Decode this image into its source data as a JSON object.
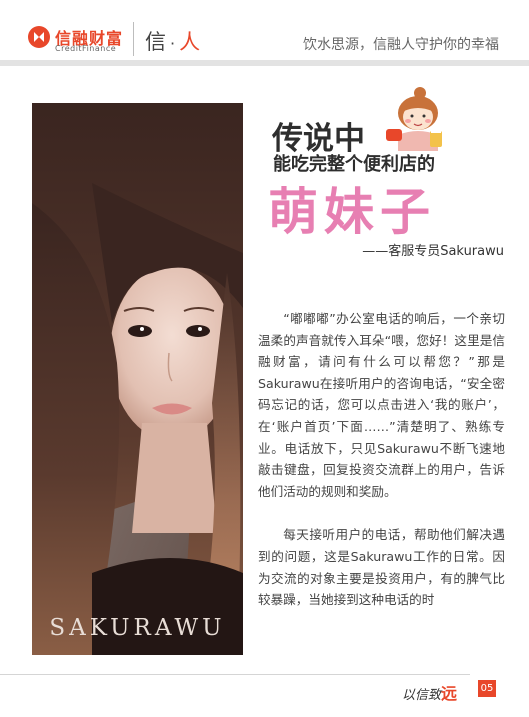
{
  "header": {
    "logo_cn": "信融财富",
    "logo_en": "CreditFinance",
    "section_char1": "信",
    "section_dot": "·",
    "section_char2": "人",
    "slogan": "饮水思源，信融人守护你的幸福"
  },
  "photo": {
    "caption": "SAKURAWU"
  },
  "title": {
    "line1": "传说中",
    "line2": "能吃完整个便利店的",
    "line3": "萌妹子",
    "byline": "——客服专员Sakurawu"
  },
  "article": {
    "paragraphs": [
      "“嘟嘟嘟”办公室电话的响后，一个亲切温柔的声音就传入耳朵“喂，您好！这里是信融财富，请问有什么可以帮您？”那是Sakurawu在接听用户的咨询电话，“安全密码忘记的话，您可以点击进入‘我的账户’，在‘账户首页’下面……”清楚明了、熟练专业。电话放下，只见Sakurawu不断飞速地敲击键盘，回复投资交流群上的用户，告诉他们活动的规则和奖励。",
      "每天接听用户的电话，帮助他们解决遇到的问题，这是Sakurawu工作的日常。因为交流的对象主要是投资用户，有的脾气比较暴躁，当她接到这种电话的时"
    ]
  },
  "footer": {
    "brand_text": "以信致",
    "brand_accent": "远",
    "page_number": "05"
  },
  "colors": {
    "brand_red": "#e8472a",
    "title_pink": "#e77fb2"
  }
}
